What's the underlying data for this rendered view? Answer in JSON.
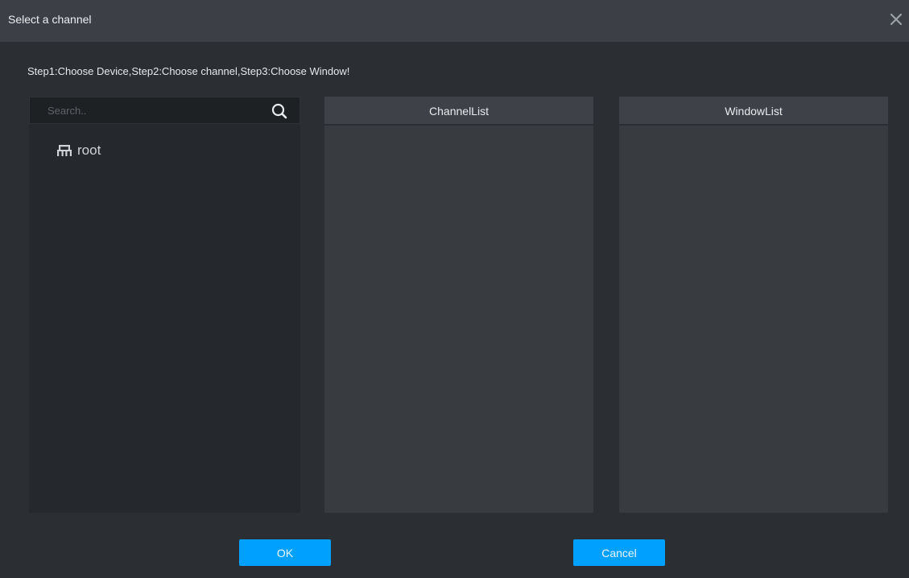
{
  "dialog": {
    "title": "Select a channel",
    "instruction": "Step1:Choose Device,Step2:Choose channel,Step3:Choose Window!"
  },
  "search": {
    "placeholder": "Search..",
    "icon": "search-icon"
  },
  "tree": {
    "root": {
      "label": "root",
      "icon": "organization-icon"
    }
  },
  "channel_list": {
    "header": "ChannelList",
    "items": []
  },
  "window_list": {
    "header": "WindowList",
    "items": []
  },
  "buttons": {
    "ok": "OK",
    "cancel": "Cancel"
  },
  "colors": {
    "accent": "#00a0ff",
    "background": "#2b2e33",
    "titlebar": "#3c4046"
  }
}
